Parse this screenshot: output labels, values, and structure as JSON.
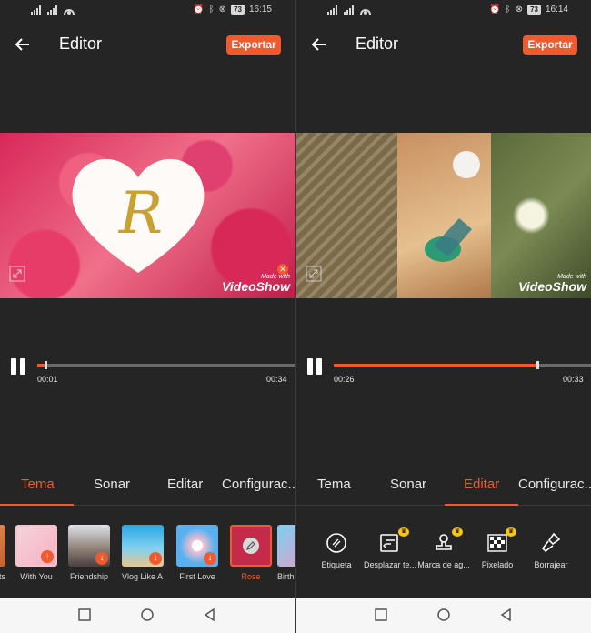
{
  "status": {
    "left_time": "16:15",
    "right_time": "16:14",
    "battery_left": "73",
    "battery_right": "73"
  },
  "left": {
    "header_title": "Editor",
    "export_label": "Exportar",
    "watermark_small": "Made with",
    "watermark_big": "VideoShow",
    "current_time": "00:01",
    "total_time": "00:34",
    "progress": 0.03,
    "tabs": [
      "Tema",
      "Sonar",
      "Editar",
      "Configurac..."
    ],
    "active_tab": "Tema",
    "themes": [
      {
        "label": "ts"
      },
      {
        "label": "With You"
      },
      {
        "label": "Friendship"
      },
      {
        "label": "Vlog Like A P..."
      },
      {
        "label": "First Love"
      },
      {
        "label": "Rose"
      },
      {
        "label": "Birth"
      }
    ],
    "selected_theme": "Rose"
  },
  "right": {
    "header_title": "Editor",
    "export_label": "Exportar",
    "watermark_small": "Made with",
    "watermark_big": "VideoShow",
    "current_time": "00:26",
    "total_time": "00:33",
    "progress": 0.79,
    "tabs": [
      "Tema",
      "Sonar",
      "Editar",
      "Configurac..."
    ],
    "active_tab": "Editar",
    "tools": [
      {
        "label": "Etiqueta",
        "icon": "sticker-icon"
      },
      {
        "label": "Desplazar te...",
        "icon": "scroll-text-icon"
      },
      {
        "label": "Marca de ag...",
        "icon": "stamp-icon"
      },
      {
        "label": "Pixelado",
        "icon": "mosaic-icon"
      },
      {
        "label": "Borrajear",
        "icon": "brush-icon"
      }
    ]
  },
  "colors": {
    "accent": "#f05a2e",
    "bg": "#252525",
    "crown": "#f7c316"
  }
}
